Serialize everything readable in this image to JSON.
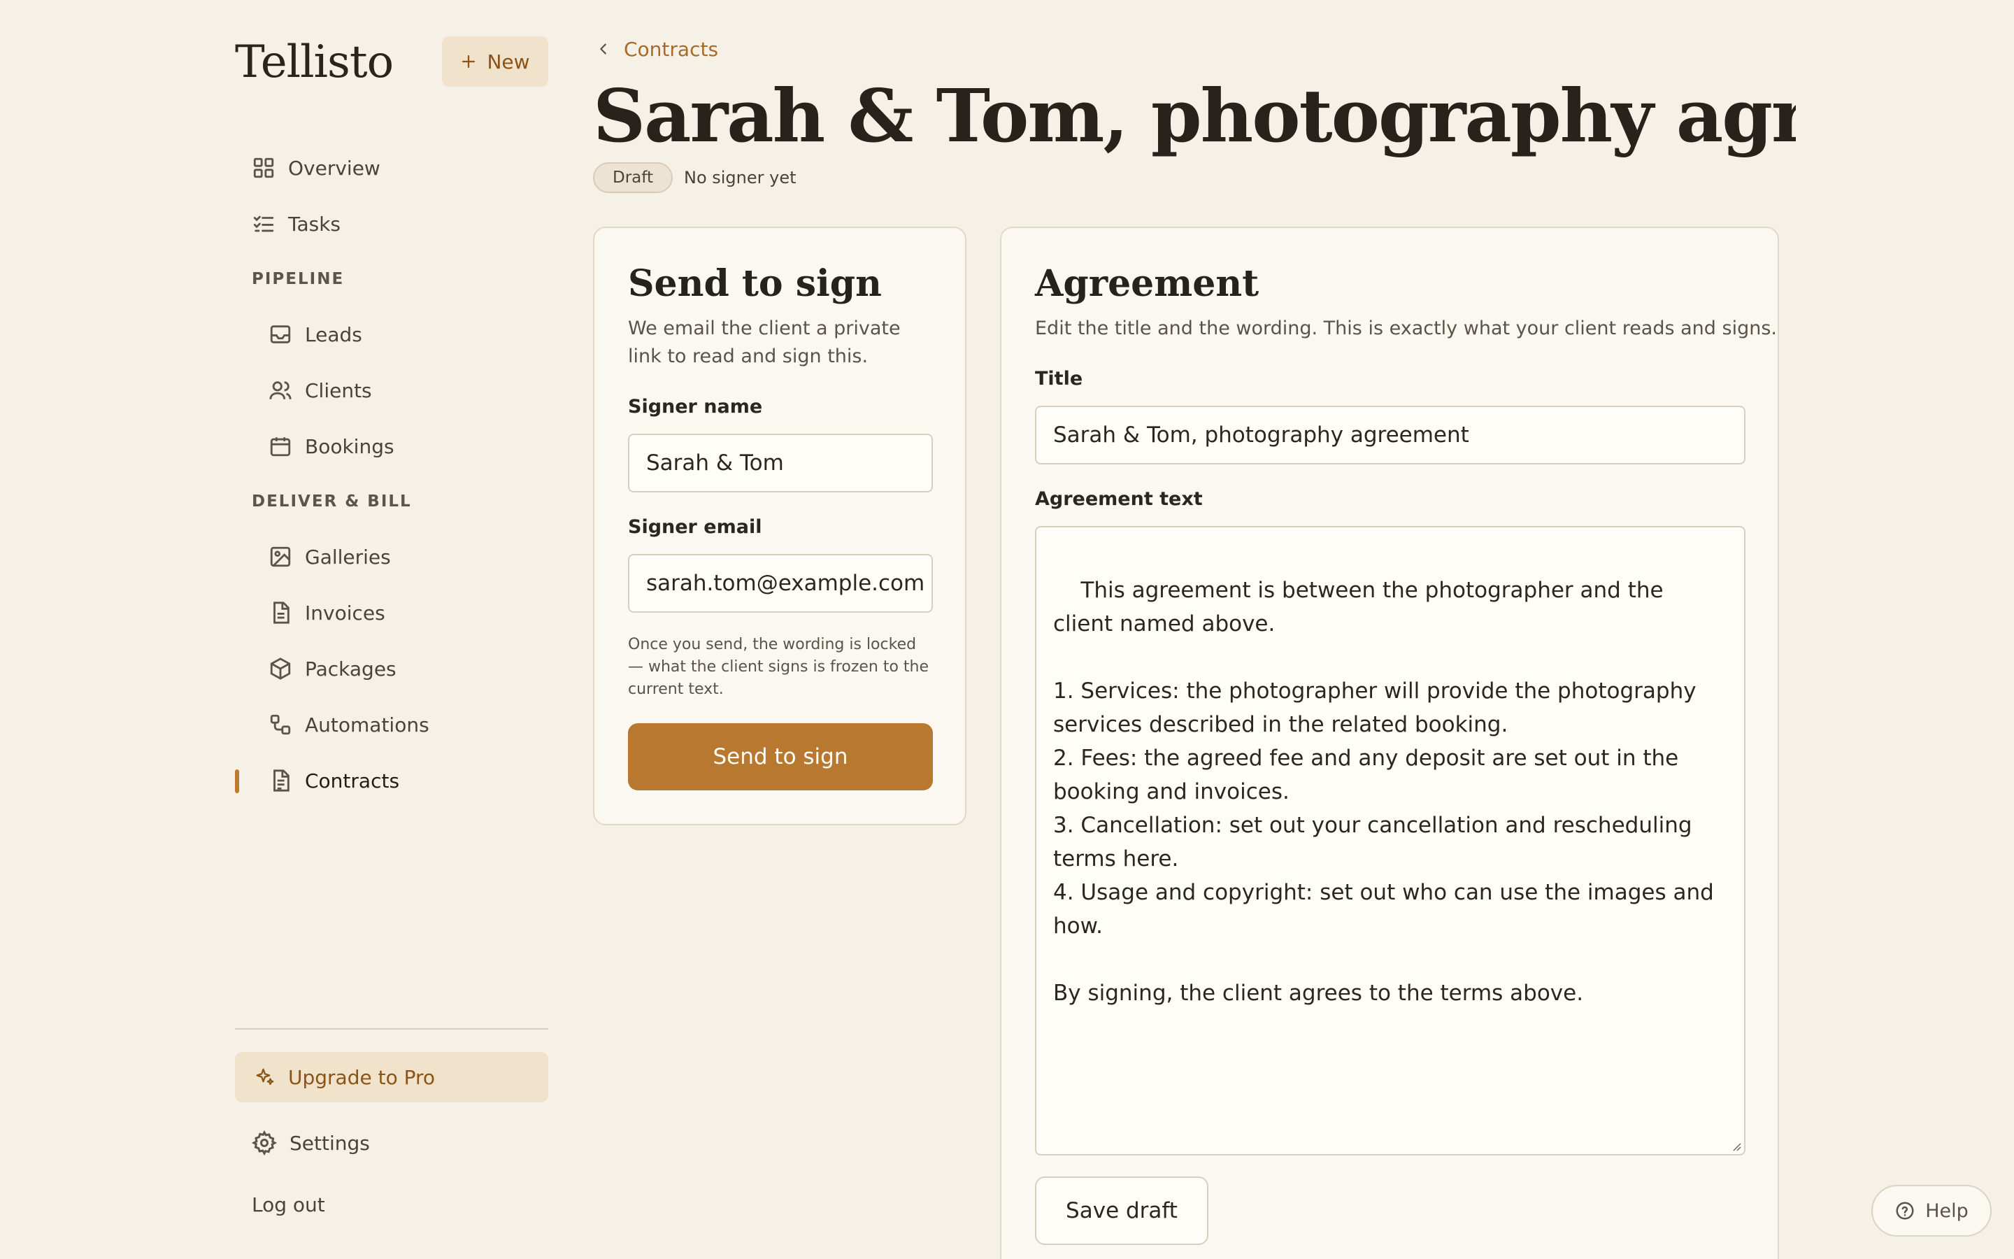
{
  "brand": "Tellisto",
  "new_button": "New",
  "nav": {
    "overview": "Overview",
    "tasks": "Tasks",
    "pipeline_label": "PIPELINE",
    "leads": "Leads",
    "clients": "Clients",
    "bookings": "Bookings",
    "deliver_label": "DELIVER & BILL",
    "galleries": "Galleries",
    "invoices": "Invoices",
    "packages": "Packages",
    "automations": "Automations",
    "contracts": "Contracts"
  },
  "footer": {
    "upgrade": "Upgrade to Pro",
    "settings": "Settings",
    "logout": "Log out"
  },
  "header": {
    "breadcrumb": "Contracts",
    "title": "Sarah & Tom, photography agreem…",
    "badge": "Draft",
    "status": "No signer yet"
  },
  "send_card": {
    "title": "Send to sign",
    "description": "We email the client a private link to read and sign this.",
    "signer_name_label": "Signer name",
    "signer_name_value": "Sarah & Tom",
    "signer_email_label": "Signer email",
    "signer_email_value": "sarah.tom@example.com",
    "note": "Once you send, the wording is locked — what the client signs is frozen to the current text.",
    "button": "Send to sign"
  },
  "agreement_card": {
    "title": "Agreement",
    "description": "Edit the title and the wording. This is exactly what your client reads and signs.",
    "title_label": "Title",
    "title_value": "Sarah & Tom, photography agreement",
    "text_label": "Agreement text",
    "text_value": "This agreement is between the photographer and the client named above.\n\n1. Services: the photographer will provide the photography services described in the related booking.\n2. Fees: the agreed fee and any deposit are set out in the booking and invoices.\n3. Cancellation: set out your cancellation and rescheduling terms here.\n4. Usage and copyright: set out who can use the images and how.\n\nBy signing, the client agrees to the terms above.",
    "save_button": "Save draft"
  },
  "help": "Help",
  "colors": {
    "background": "#f6f1e7",
    "accent": "#b87830",
    "accent_soft": "#f1e2cb",
    "accent_text": "#8a5416"
  },
  "icons": {
    "overview": "grid-icon",
    "tasks": "checklist-icon",
    "leads": "inbox-icon",
    "clients": "users-icon",
    "bookings": "calendar-icon",
    "galleries": "image-icon",
    "invoices": "file-icon",
    "packages": "box-icon",
    "automations": "workflow-icon",
    "contracts": "document-icon",
    "upgrade": "sparkle-icon",
    "settings": "gear-icon",
    "help": "question-icon"
  }
}
